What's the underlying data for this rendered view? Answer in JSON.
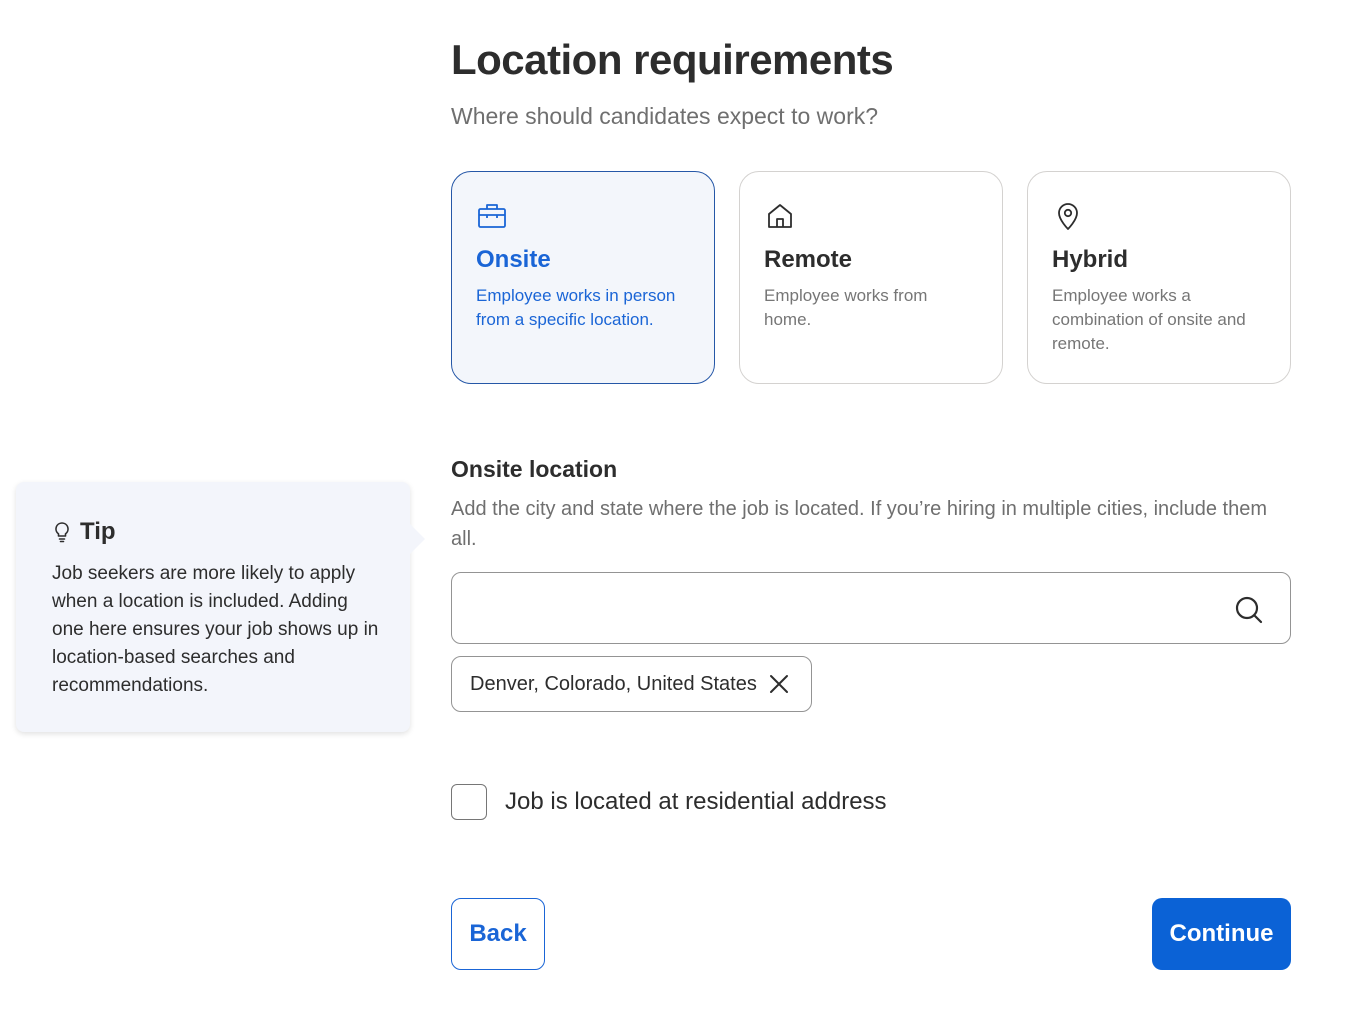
{
  "page": {
    "title": "Location requirements",
    "subtitle": "Where should candidates expect to work?"
  },
  "options": [
    {
      "id": "onsite",
      "title": "Onsite",
      "description": "Employee works in person from a specific location.",
      "icon": "briefcase-icon",
      "selected": true
    },
    {
      "id": "remote",
      "title": "Remote",
      "description": "Employee works from home.",
      "icon": "home-icon",
      "selected": false
    },
    {
      "id": "hybrid",
      "title": "Hybrid",
      "description": "Employee works a combination of onsite and remote.",
      "icon": "map-pin-icon",
      "selected": false
    }
  ],
  "onsite_location": {
    "title": "Onsite location",
    "description": "Add the city and state where the job is located. If you’re hiring in multiple cities, include them all.",
    "search_value": "",
    "selected_locations": [
      "Denver, Colorado, United States"
    ]
  },
  "residential": {
    "label": "Job is located at residential address",
    "checked": false
  },
  "buttons": {
    "back": "Back",
    "continue": "Continue"
  },
  "tip": {
    "title": "Tip",
    "body": "Job seekers are more likely to apply when a location is included. Adding one here ensures your job shows up in location-based searches and recommendations."
  },
  "colors": {
    "accent": "#1a65d6",
    "primary_button": "#0b62d6",
    "selected_card_bg": "#f3f6fb",
    "tip_bg": "#f3f5fb"
  }
}
